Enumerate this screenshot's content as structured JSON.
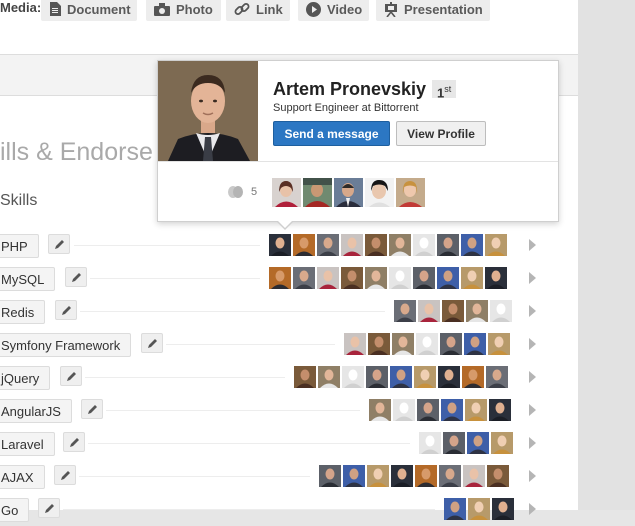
{
  "media": {
    "label": "Media:",
    "buttons": [
      {
        "label": "Document",
        "icon": "document-icon"
      },
      {
        "label": "Photo",
        "icon": "camera-icon"
      },
      {
        "label": "Link",
        "icon": "link-icon"
      },
      {
        "label": "Video",
        "icon": "play-icon"
      },
      {
        "label": "Presentation",
        "icon": "presentation-icon"
      }
    ]
  },
  "section": {
    "title": "ills & Endorse",
    "subtitle": "Skills"
  },
  "skills": [
    {
      "name": "PHP",
      "endorsers": 10
    },
    {
      "name": "MySQL",
      "endorsers": 10
    },
    {
      "name": "Redis",
      "endorsers": 5
    },
    {
      "name": "Symfony Framework",
      "endorsers": 7
    },
    {
      "name": "jQuery",
      "endorsers": 9
    },
    {
      "name": "AngularJS",
      "endorsers": 6
    },
    {
      "name": "Laravel",
      "endorsers": 4
    },
    {
      "name": "AJAX",
      "endorsers": 8
    },
    {
      "name": "Go",
      "endorsers": 3
    }
  ],
  "profile_card": {
    "name": "Artem Pronevskiy",
    "degree": "1",
    "degree_suffix": "st",
    "headline": "Support Engineer at Bittorrent",
    "send_message": "Send a message",
    "view_profile": "View Profile",
    "shared_connections_count": "5"
  },
  "colors": {
    "primary_button": "#2c77c3",
    "section_title": "#a9a9a9"
  }
}
